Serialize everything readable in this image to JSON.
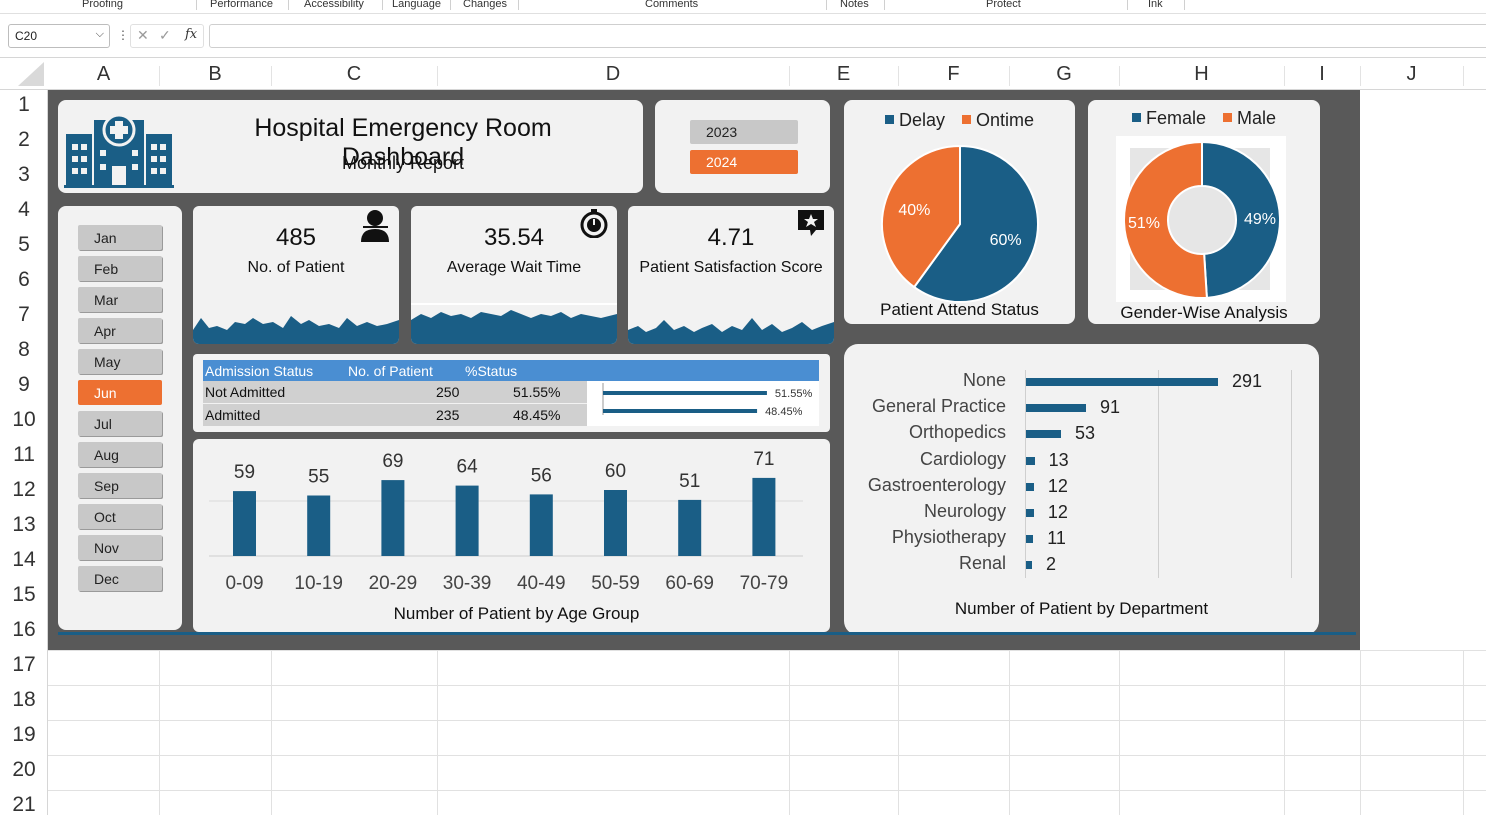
{
  "ribbon": {
    "groups": [
      "Proofing",
      "Performance",
      "Accessibility",
      "Language",
      "Changes",
      "Comments",
      "Notes",
      "Protect",
      "Ink"
    ]
  },
  "formula_bar": {
    "name_box": "C20",
    "formula": "",
    "fx_label": "fx"
  },
  "columns": [
    "A",
    "B",
    "C",
    "D",
    "E",
    "F",
    "G",
    "H",
    "I",
    "J"
  ],
  "rows": [
    "1",
    "2",
    "3",
    "4",
    "5",
    "6",
    "7",
    "8",
    "9",
    "10",
    "11",
    "12",
    "13",
    "14",
    "15",
    "16",
    "17",
    "18",
    "19",
    "20",
    "21"
  ],
  "dashboard": {
    "title": "Hospital Emergency Room Dashboard",
    "subtitle": "Monthly Report",
    "years": [
      {
        "label": "2023",
        "selected": false
      },
      {
        "label": "2024",
        "selected": true
      }
    ],
    "months": [
      {
        "label": "Jan",
        "selected": false
      },
      {
        "label": "Feb",
        "selected": false
      },
      {
        "label": "Mar",
        "selected": false
      },
      {
        "label": "Apr",
        "selected": false
      },
      {
        "label": "May",
        "selected": false
      },
      {
        "label": "Jun",
        "selected": true
      },
      {
        "label": "Jul",
        "selected": false
      },
      {
        "label": "Aug",
        "selected": false
      },
      {
        "label": "Sep",
        "selected": false
      },
      {
        "label": "Oct",
        "selected": false
      },
      {
        "label": "Nov",
        "selected": false
      },
      {
        "label": "Dec",
        "selected": false
      }
    ],
    "kpis": [
      {
        "value": "485",
        "label": "No. of Patient",
        "icon": "doctor-icon"
      },
      {
        "value": "35.54",
        "label": "Average Wait Time",
        "icon": "stopwatch-icon"
      },
      {
        "value": "4.71",
        "label": "Patient Satisfaction Score",
        "icon": "star-comment-icon"
      }
    ],
    "admission": {
      "headers": [
        "Admission Status",
        "No. of Patient",
        "%Status"
      ],
      "rows": [
        {
          "status": "Not Admitted",
          "count": "250",
          "pct": "51.55%",
          "fraction": 0.5155
        },
        {
          "status": "Admitted",
          "count": "235",
          "pct": "48.45%",
          "fraction": 0.4845
        }
      ]
    },
    "colors": {
      "accent_blue": "#1a5e86",
      "accent_orange": "#ed7031",
      "header_blue": "#4a8ed2",
      "dashboard_bg": "#595959",
      "card_bg": "#f2f2f2"
    }
  },
  "chart_data": [
    {
      "type": "bar",
      "title": "Number of Patient by Age Group",
      "categories": [
        "0-09",
        "10-19",
        "20-29",
        "30-39",
        "40-49",
        "50-59",
        "60-69",
        "70-79"
      ],
      "values": [
        59,
        55,
        69,
        64,
        56,
        60,
        51,
        71
      ],
      "ylim": [
        0,
        100
      ],
      "grid": false
    },
    {
      "type": "pie",
      "title": "Patient Attend Status",
      "categories": [
        "Delay",
        "Ontime"
      ],
      "values": [
        60,
        40
      ],
      "labels": [
        "60%",
        "40%"
      ],
      "legend": "top"
    },
    {
      "type": "pie",
      "title": "Gender-Wise Analysis",
      "categories": [
        "Female",
        "Male"
      ],
      "values": [
        49,
        51
      ],
      "labels": [
        "49%",
        "51%"
      ],
      "legend": "top"
    },
    {
      "type": "bar",
      "orientation": "horizontal",
      "title": "Number of Patient by Department",
      "categories": [
        "None",
        "General Practice",
        "Orthopedics",
        "Cardiology",
        "Gastroenterology",
        "Neurology",
        "Physiotherapy",
        "Renal"
      ],
      "values": [
        291,
        91,
        53,
        13,
        12,
        12,
        11,
        2
      ]
    }
  ]
}
